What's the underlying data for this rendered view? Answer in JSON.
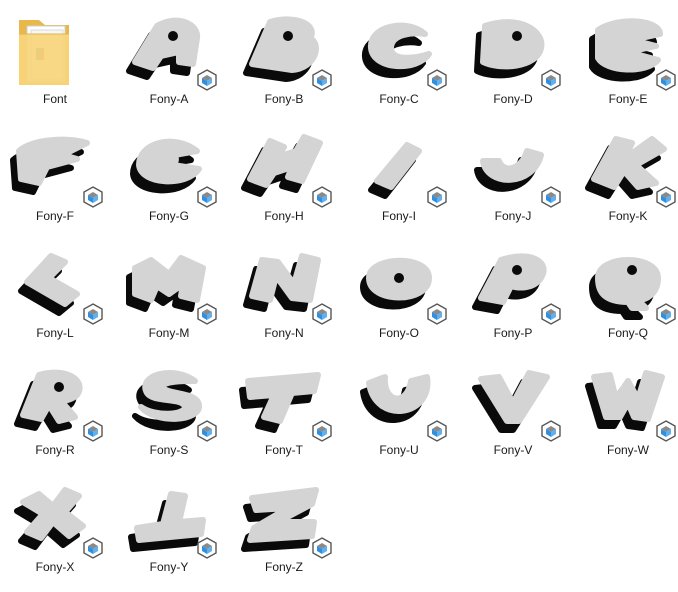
{
  "folder": {
    "label": "Font",
    "icon": "folder-icon"
  },
  "items": [
    {
      "label": "Fony-A",
      "letter": "A"
    },
    {
      "label": "Fony-B",
      "letter": "B"
    },
    {
      "label": "Fony-C",
      "letter": "C"
    },
    {
      "label": "Fony-D",
      "letter": "D"
    },
    {
      "label": "Fony-E",
      "letter": "E"
    },
    {
      "label": "Fony-F",
      "letter": "F"
    },
    {
      "label": "Fony-G",
      "letter": "G"
    },
    {
      "label": "Fony-H",
      "letter": "H"
    },
    {
      "label": "Fony-I",
      "letter": "I"
    },
    {
      "label": "Fony-J",
      "letter": "J"
    },
    {
      "label": "Fony-K",
      "letter": "K"
    },
    {
      "label": "Fony-L",
      "letter": "L"
    },
    {
      "label": "Fony-M",
      "letter": "M"
    },
    {
      "label": "Fony-N",
      "letter": "N"
    },
    {
      "label": "Fony-O",
      "letter": "O"
    },
    {
      "label": "Fony-P",
      "letter": "P"
    },
    {
      "label": "Fony-Q",
      "letter": "Q"
    },
    {
      "label": "Fony-R",
      "letter": "R"
    },
    {
      "label": "Fony-S",
      "letter": "S"
    },
    {
      "label": "Fony-T",
      "letter": "T"
    },
    {
      "label": "Fony-U",
      "letter": "U"
    },
    {
      "label": "Fony-V",
      "letter": "V"
    },
    {
      "label": "Fony-W",
      "letter": "W"
    },
    {
      "label": "Fony-X",
      "letter": "X"
    },
    {
      "label": "Fony-Y",
      "letter": "Y"
    },
    {
      "label": "Fony-Z",
      "letter": "Z"
    }
  ],
  "colors": {
    "glyph_face": "#d4d4d4",
    "glyph_extrusion": "#0a0a0a",
    "folder_back": "#e8b94a",
    "folder_front": "#f7d57a",
    "badge_border": "#555555",
    "badge_blue": "#2f8fe0",
    "badge_gray": "#8a8a8a"
  }
}
